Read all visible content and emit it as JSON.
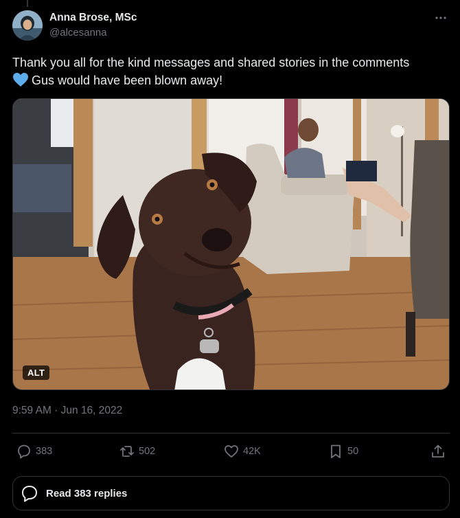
{
  "author": {
    "display_name": "Anna Brose, MSc",
    "handle": "@alcesanna"
  },
  "post": {
    "text_line1": "Thank you all for the kind messages and shared stories in the comments",
    "text_line2": "Gus would have been blown away!",
    "emoji": "blue-heart",
    "media_alt_badge": "ALT",
    "timestamp": "9:59 AM · Jun 16, 2022"
  },
  "stats": {
    "replies": "383",
    "reposts": "502",
    "likes": "42K",
    "bookmarks": "50"
  },
  "read_replies_label": "Read 383 replies",
  "icons": [
    "more-icon",
    "reply-icon",
    "repost-icon",
    "like-icon",
    "bookmark-icon",
    "share-icon",
    "chat-bubble-icon"
  ],
  "colors": {
    "background": "#000000",
    "primary_text": "#e7e9ea",
    "secondary_text": "#71767b",
    "border": "#2f3336",
    "heart_emoji": "#5dadec"
  }
}
